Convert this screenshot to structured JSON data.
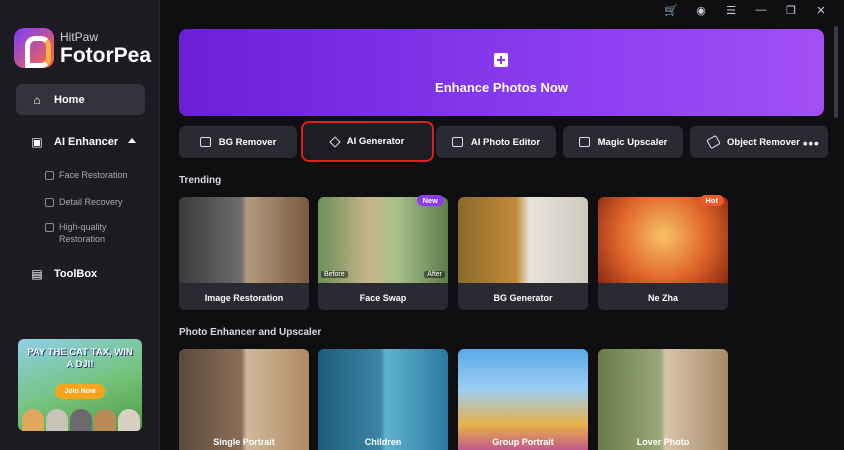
{
  "app": {
    "brand_small": "HitPaw",
    "brand_big": "FotorPea"
  },
  "sidebar": {
    "home": "Home",
    "ai_enhancer": "AI Enhancer",
    "sub_items": [
      "Face Restoration",
      "Detail Recovery",
      "High-quality Restoration"
    ],
    "toolbox": "ToolBox"
  },
  "promo": {
    "title": "PAY THE CAT TAX, WIN A DJI!",
    "button": "Join Now"
  },
  "topbar": {
    "icons": [
      "cart-icon",
      "user-icon",
      "menu-icon",
      "minimize-icon",
      "restore-icon",
      "close-icon"
    ]
  },
  "banner": {
    "label": "Enhance Photos Now"
  },
  "tools": {
    "items": [
      "BG Remover",
      "AI Generator",
      "AI Photo Editor",
      "Magic Upscaler",
      "Object Remover"
    ],
    "selected": "AI Generator",
    "more": "•••"
  },
  "trending": {
    "title": "Trending",
    "cards": [
      {
        "label": "Image Restoration"
      },
      {
        "label": "Face Swap",
        "badge": "New",
        "tag_left": "Before",
        "tag_right": "After"
      },
      {
        "label": "BG Generator"
      },
      {
        "label": "Ne Zha",
        "badge": "Hot"
      }
    ]
  },
  "upscaler": {
    "title": "Photo Enhancer and Upscaler",
    "cards": [
      {
        "label": "Single Portrait"
      },
      {
        "label": "Children"
      },
      {
        "label": "Group Portrait"
      },
      {
        "label": "Lover Photo"
      }
    ]
  },
  "colors": {
    "accent": "#8b3df0",
    "selection": "#e21d1d",
    "new_badge": "#8a3df0",
    "hot_badge": "#f05a28"
  }
}
